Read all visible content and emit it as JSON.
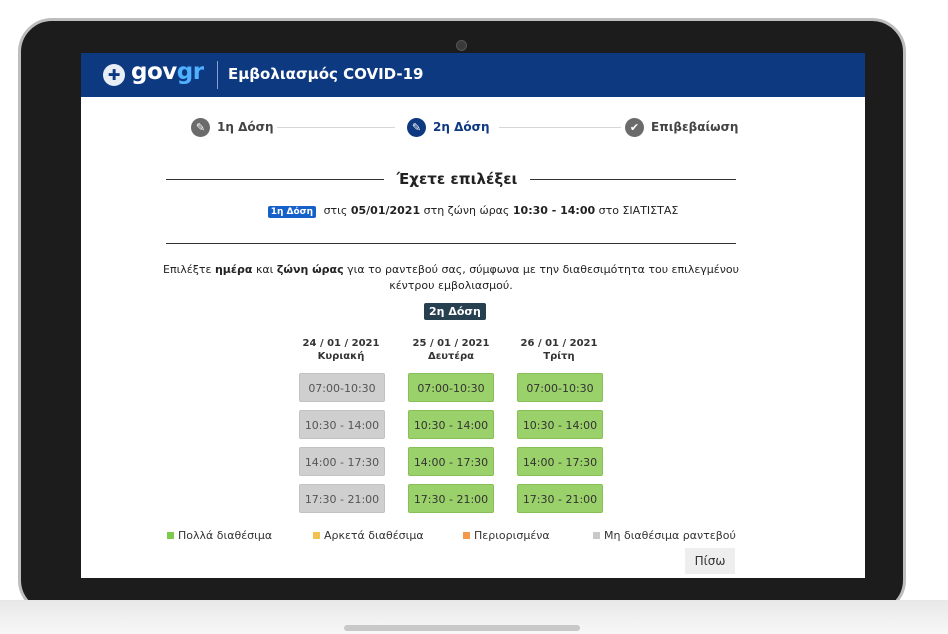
{
  "header": {
    "logo_text_main": "gov",
    "logo_text_accent": "gr",
    "app_title": "Εμβολιασμός COVID-19"
  },
  "steps": [
    {
      "label": "1η Δόση",
      "icon": "pencil-icon"
    },
    {
      "label": "2η Δόση",
      "icon": "pencil-icon"
    },
    {
      "label": "Επιβεβαίωση",
      "icon": "check-icon"
    }
  ],
  "selection": {
    "title": "Έχετε επιλέξει",
    "dose_badge": "1η Δόση",
    "text_prefix": "στις",
    "date": "05/01/2021",
    "text_mid": "στη ζώνη ώρας",
    "time": "10:30 - 14:00",
    "text_suffix": "στο ΣΙΑΤΙΣΤΑΣ"
  },
  "instructions": {
    "part1": "Επιλέξτε",
    "bold1": "ημέρα",
    "part2": "και",
    "bold2": "ζώνη ώρας",
    "part3": "για το ραντεβού σας, σύμφωνα με την διαθεσιμότητα του επιλεγμένου κέντρου εμβολιασμού."
  },
  "dose_tag": "2η Δόση",
  "days": [
    {
      "date": "24 / 01 / 2021",
      "weekday": "Κυριακή",
      "slots": [
        {
          "time": "07:00-10:30",
          "status": "unavailable"
        },
        {
          "time": "10:30 - 14:00",
          "status": "unavailable"
        },
        {
          "time": "14:00 - 17:30",
          "status": "unavailable"
        },
        {
          "time": "17:30 - 21:00",
          "status": "unavailable"
        }
      ]
    },
    {
      "date": "25 / 01 / 2021",
      "weekday": "Δευτέρα",
      "slots": [
        {
          "time": "07:00-10:30",
          "status": "many"
        },
        {
          "time": "10:30 - 14:00",
          "status": "many"
        },
        {
          "time": "14:00 - 17:30",
          "status": "many"
        },
        {
          "time": "17:30 - 21:00",
          "status": "many"
        }
      ]
    },
    {
      "date": "26 / 01 / 2021",
      "weekday": "Τρίτη",
      "slots": [
        {
          "time": "07:00-10:30",
          "status": "many"
        },
        {
          "time": "10:30 - 14:00",
          "status": "many"
        },
        {
          "time": "14:00 - 17:30",
          "status": "many"
        },
        {
          "time": "17:30 - 21:00",
          "status": "many"
        }
      ]
    }
  ],
  "legend": [
    {
      "label": "Πολλά διαθέσιμα",
      "color": "#7ccb4c"
    },
    {
      "label": "Αρκετά διαθέσιμα",
      "color": "#f2c14e"
    },
    {
      "label": "Περιορισμένα",
      "color": "#f2994a"
    },
    {
      "label": "Μη διαθέσιμα ραντεβού",
      "color": "#c9c9c9"
    }
  ],
  "back_label": "Πίσω"
}
